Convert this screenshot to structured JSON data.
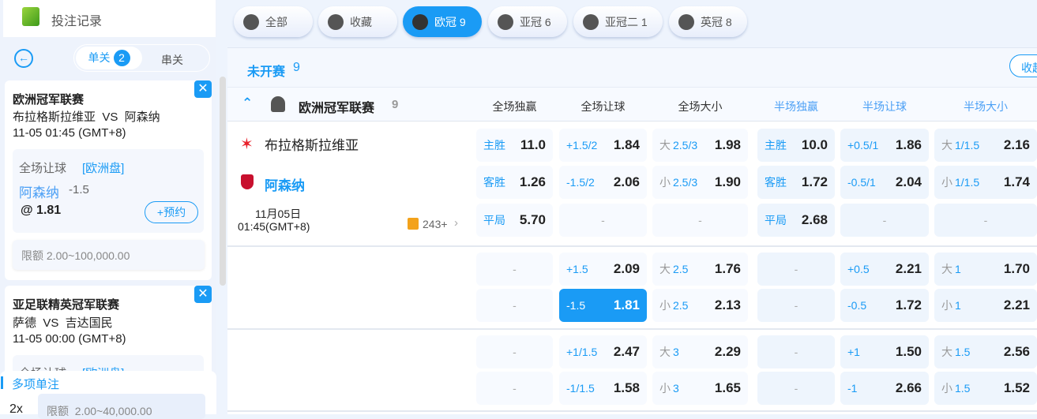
{
  "sidebar": {
    "title": "投注记录",
    "tabs": {
      "single": "单关",
      "single_count": "2",
      "parlay": "串关"
    },
    "bets": [
      {
        "league": "欧洲冠军联赛",
        "match": "布拉格斯拉维亚  VS  阿森纳",
        "time": "11-05 01:45 (GMT+8)",
        "market": "全场让球",
        "odds_type": "[欧洲盘]",
        "pick": "阿森纳",
        "line": "-1.5",
        "odds": "@ 1.81",
        "reserve": "+预约",
        "limit": "限额 2.00~100,000.00"
      },
      {
        "league": "亚足联精英冠军联赛",
        "match": "萨德  VS  吉达国民",
        "time": "11-05 00:00 (GMT+8)",
        "market": "全场让球",
        "odds_type": "[欧洲盘]"
      }
    ],
    "multi": {
      "title": "多项单注",
      "mult": "2x",
      "limit": "限额  2.00~40,000.00"
    }
  },
  "tabs": [
    {
      "label": "全部",
      "icon": "grid-icon"
    },
    {
      "label": "收藏",
      "icon": "star-icon"
    },
    {
      "label": "欧冠 9",
      "icon": "ucl-trophy-icon",
      "active": true
    },
    {
      "label": "亚冠 6",
      "icon": "afc-trophy-icon"
    },
    {
      "label": "亚冠二 1",
      "icon": "afc2-trophy-icon"
    },
    {
      "label": "英冠 8",
      "icon": "efl-icon"
    }
  ],
  "section": {
    "title": "未开赛",
    "count": "9",
    "collapse": "收起"
  },
  "league": {
    "name": "欧洲冠军联赛",
    "count": "9",
    "columns": [
      "全场独赢",
      "全场让球",
      "全场大小",
      "半场独赢",
      "半场让球",
      "半场大小"
    ]
  },
  "match": {
    "home": "布拉格斯拉维亚",
    "away": "阿森纳",
    "date": "11月05日",
    "time": "01:45(GMT+8)",
    "markets": "243+",
    "colors": {
      "accent": "#1a9bf5"
    }
  },
  "blocks": [
    [
      [
        {
          "l": "主胜",
          "o": "11.0"
        },
        {
          "l": "+1.5/2",
          "o": "1.84"
        },
        {
          "p": "大",
          "l": "2.5/3",
          "o": "1.98"
        },
        {
          "l": "主胜",
          "o": "10.0"
        },
        {
          "l": "+0.5/1",
          "o": "1.86"
        },
        {
          "p": "大",
          "l": "1/1.5",
          "o": "2.16"
        }
      ],
      [
        {
          "l": "客胜",
          "o": "1.26"
        },
        {
          "l": "-1.5/2",
          "o": "2.06"
        },
        {
          "p": "小",
          "l": "2.5/3",
          "o": "1.90"
        },
        {
          "l": "客胜",
          "o": "1.72"
        },
        {
          "l": "-0.5/1",
          "o": "2.04"
        },
        {
          "p": "小",
          "l": "1/1.5",
          "o": "1.74"
        }
      ],
      [
        {
          "l": "平局",
          "o": "5.70"
        },
        {
          "d": "-"
        },
        {
          "d": "-"
        },
        {
          "l": "平局",
          "o": "2.68"
        },
        {
          "d": "-"
        },
        {
          "d": "-"
        }
      ]
    ],
    [
      [
        {
          "d": "-"
        },
        {
          "l": "+1.5",
          "o": "2.09"
        },
        {
          "p": "大",
          "l": "2.5",
          "o": "1.76"
        },
        {
          "d": "-"
        },
        {
          "l": "+0.5",
          "o": "2.21"
        },
        {
          "p": "大",
          "l": "1",
          "o": "1.70"
        }
      ],
      [
        {
          "d": "-"
        },
        {
          "l": "-1.5",
          "o": "1.81",
          "sel": true
        },
        {
          "p": "小",
          "l": "2.5",
          "o": "2.13"
        },
        {
          "d": "-"
        },
        {
          "l": "-0.5",
          "o": "1.72"
        },
        {
          "p": "小",
          "l": "1",
          "o": "2.21"
        }
      ]
    ],
    [
      [
        {
          "d": "-"
        },
        {
          "l": "+1/1.5",
          "o": "2.47"
        },
        {
          "p": "大",
          "l": "3",
          "o": "2.29"
        },
        {
          "d": "-"
        },
        {
          "l": "+1",
          "o": "1.50"
        },
        {
          "p": "大",
          "l": "1.5",
          "o": "2.56"
        }
      ],
      [
        {
          "d": "-"
        },
        {
          "l": "-1/1.5",
          "o": "1.58"
        },
        {
          "p": "小",
          "l": "3",
          "o": "1.65"
        },
        {
          "d": "-"
        },
        {
          "l": "-1",
          "o": "2.66"
        },
        {
          "p": "小",
          "l": "1.5",
          "o": "1.52"
        }
      ]
    ]
  ]
}
